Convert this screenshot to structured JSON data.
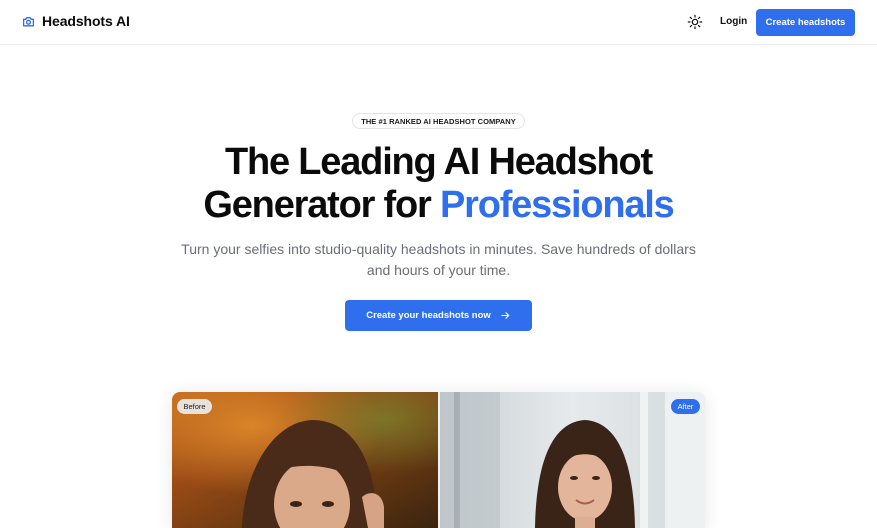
{
  "header": {
    "brand": "Headshots AI",
    "icons": {
      "logo": "camera-icon",
      "theme": "sun-icon"
    },
    "login": "Login",
    "cta": "Create headshots"
  },
  "hero": {
    "badge": "THE #1 RANKED AI HEADSHOT COMPANY",
    "headline_line1": "The Leading AI Headshot",
    "headline_line2_prefix": "Generator for ",
    "headline_accent": "Professionals",
    "subtext": "Turn your selfies into studio-quality headshots in minutes. Save hundreds of dollars and hours of your time.",
    "cta": "Create your headshots now",
    "cta_icon": "arrow-right-icon"
  },
  "comparison": {
    "before_label": "Before",
    "after_label": "After"
  },
  "colors": {
    "accent": "#2f6fed",
    "text": "#0b0b0c",
    "muted": "#6b6e78"
  }
}
